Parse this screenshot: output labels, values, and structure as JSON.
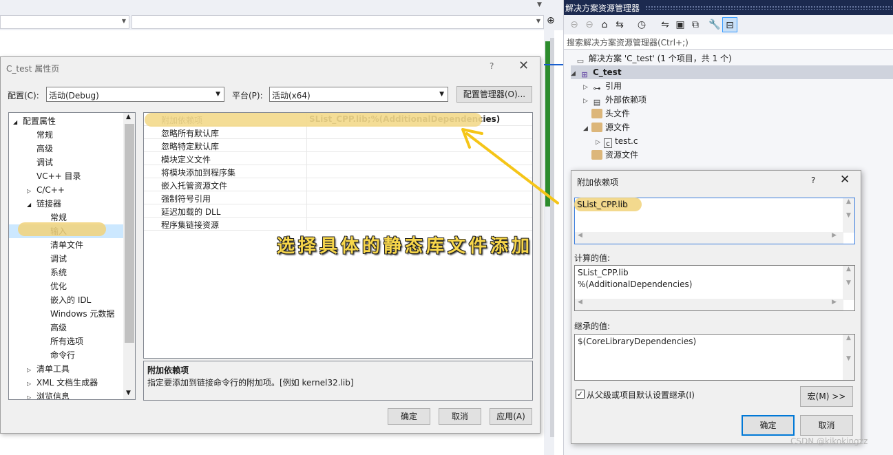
{
  "top_bar": {
    "right_icon": "pin-split-icon"
  },
  "solution_explorer": {
    "title": "解决方案资源管理器",
    "search_placeholder": "搜索解决方案资源管理器(Ctrl+;)",
    "tree": [
      {
        "label": "解决方案 'C_test' (1 个项目，共 1 个)",
        "icon": "solution-icon"
      },
      {
        "label": "C_test",
        "icon": "project-icon"
      },
      {
        "label": "引用",
        "icon": "references-icon"
      },
      {
        "label": "外部依赖项",
        "icon": "external-deps-icon"
      },
      {
        "label": "头文件",
        "icon": "folder-icon"
      },
      {
        "label": "源文件",
        "icon": "folder-icon"
      },
      {
        "label": "test.c",
        "icon": "c-file-icon"
      },
      {
        "label": "资源文件",
        "icon": "folder-icon"
      }
    ]
  },
  "property_dialog": {
    "title": "C_test 属性页",
    "help": "?",
    "config_label": "配置(C):",
    "config_value": "活动(Debug)",
    "platform_label": "平台(P):",
    "platform_value": "活动(x64)",
    "config_manager": "配置管理器(O)...",
    "tree": [
      "配置属性",
      "常规",
      "高级",
      "调试",
      "VC++ 目录",
      "C/C++",
      "链接器",
      "常规",
      "输入",
      "清单文件",
      "调试",
      "系统",
      "优化",
      "嵌入的 IDL",
      "Windows 元数据",
      "高级",
      "所有选项",
      "命令行",
      "清单工具",
      "XML 文档生成器",
      "浏览信息"
    ],
    "grid": [
      {
        "name": "附加依赖项",
        "value": "SList_CPP.lib;%(AdditionalDependencies)"
      },
      {
        "name": "忽略所有默认库",
        "value": ""
      },
      {
        "name": "忽略特定默认库",
        "value": ""
      },
      {
        "name": "模块定义文件",
        "value": ""
      },
      {
        "name": "将模块添加到程序集",
        "value": ""
      },
      {
        "name": "嵌入托管资源文件",
        "value": ""
      },
      {
        "name": "强制符号引用",
        "value": ""
      },
      {
        "name": "延迟加载的 DLL",
        "value": ""
      },
      {
        "name": "程序集链接资源",
        "value": ""
      }
    ],
    "desc_title": "附加依赖项",
    "desc_text": "指定要添加到链接命令行的附加项。[例如 kernel32.lib]",
    "ok": "确定",
    "cancel": "取消",
    "apply": "应用(A)"
  },
  "deps_dialog": {
    "title": "附加依赖项",
    "help": "?",
    "input_value": "SList_CPP.lib",
    "computed_label": "计算的值:",
    "computed_lines": [
      "SList_CPP.lib",
      "%(AdditionalDependencies)"
    ],
    "inherited_label": "继承的值:",
    "inherited_value": "$(CoreLibraryDependencies)",
    "inherit_checkbox": "从父级或项目默认设置继承(I)",
    "inherit_checked": true,
    "macro_button": "宏(M) >>",
    "ok": "确定",
    "cancel": "取消"
  },
  "annotation": "选择具体的静态库文件添加",
  "watermark": "CSDN @kikokingzz",
  "colors": {
    "highlight": "#f1d27a",
    "annotation": "#f7d64a",
    "title_bar": "#1c2a4f",
    "progress_green": "#2d8c2d"
  }
}
